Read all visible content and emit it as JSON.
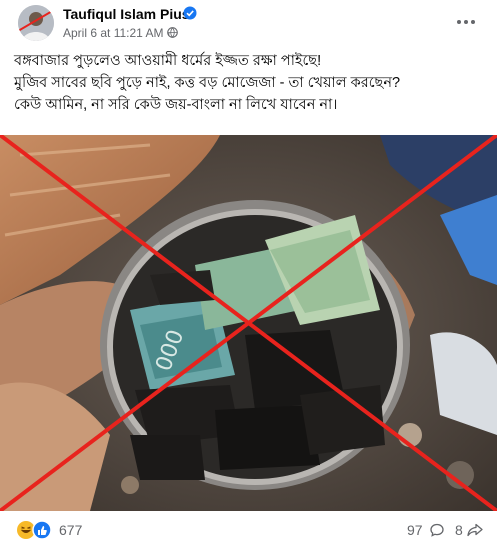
{
  "post": {
    "author": "Taufiqul Islam Pius",
    "date": "April 6 at 11:21 AM",
    "date_separator": "·",
    "caption_lines": [
      "বঙ্গবাজার পুড়লেও আওয়ামী ধর্মের ইজ্জত রক্ষা পাইছে!",
      "মুজিব সাবের ছবি পুড়ে নাই, কত্ত বড় মোজেজা - তা খেয়াল করছেন?",
      "কেউ আমিন, না সরি কেউ জয়-বাংলা না লিখে যাবেন না।"
    ]
  },
  "stats": {
    "reactions_count": "677",
    "comments_count": "97",
    "shares_count": "8"
  },
  "icons": {
    "verified": "verified-badge-icon",
    "privacy": "globe-icon",
    "more": "more-options-icon",
    "reactions": [
      "haha-reaction-icon",
      "like-reaction-icon"
    ],
    "comments": "comment-icon",
    "shares": "share-icon",
    "overlay": "red-x-cross"
  },
  "colors": {
    "verified_blue": "#1877f2",
    "cross_red": "#e8231d",
    "meta_gray": "#65676b"
  }
}
